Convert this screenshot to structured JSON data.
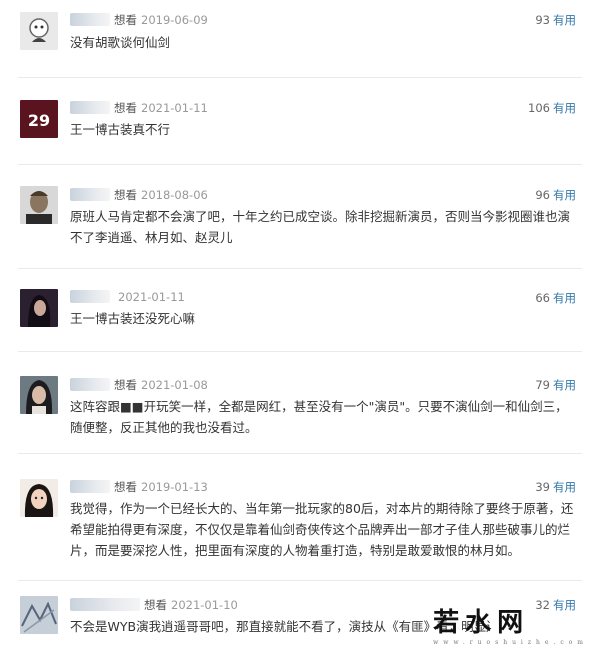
{
  "comments": [
    {
      "action": "想看",
      "date": "2019-06-09",
      "votes": "93",
      "vote_label": "有用",
      "text": "没有胡歌谈何仙剑",
      "avatar": "cartoon-face-avatar"
    },
    {
      "action": "想看",
      "date": "2021-01-11",
      "votes": "106",
      "vote_label": "有用",
      "text": "王一博古装真不行",
      "avatar": "jersey-29-avatar"
    },
    {
      "action": "想看",
      "date": "2018-08-06",
      "votes": "96",
      "vote_label": "有用",
      "text": "原班人马肯定都不会演了吧，十年之约已成空谈。除非挖掘新演员，否则当今影视圈谁也演不了李逍遥、林月如、赵灵儿",
      "avatar": "portrait-man-avatar"
    },
    {
      "action": "",
      "date": "2021-01-11",
      "votes": "66",
      "vote_label": "有用",
      "text": "王一博古装还没死心嘛",
      "avatar": "dark-hair-woman-avatar"
    },
    {
      "action": "想看",
      "date": "2021-01-08",
      "votes": "79",
      "vote_label": "有用",
      "text": "这阵容跟■■开玩笑一样，全都是网红，甚至没有一个\"演员\"。只要不演仙剑一和仙剑三，随便整，反正其他的我也没看过。",
      "avatar": "costume-hero-avatar"
    },
    {
      "action": "想看",
      "date": "2019-01-13",
      "votes": "39",
      "vote_label": "有用",
      "text": "我觉得，作为一个已经长大的、当年第一批玩家的80后，对本片的期待除了要终于原著，还希望能拍得更有深度，不仅仅是靠着仙剑奇侠传这个品牌弄出一部才子佳人那些破事儿的烂片，而是要深挖人性，把里面有深度的人物着重打造，特别是敢爱敢恨的林月如。",
      "avatar": "girl-avatar"
    },
    {
      "action": "想看",
      "date": "2021-01-10",
      "votes": "32",
      "vote_label": "有用",
      "text": "不会是WYB演我逍遥哥哥吧，那直接就能不看了，演技从《有匪》看，明显还不行啊",
      "avatar": "sketch-avatar"
    }
  ],
  "watermark": {
    "main": "若水网",
    "sub": "www.ruoshuizhe.com"
  }
}
